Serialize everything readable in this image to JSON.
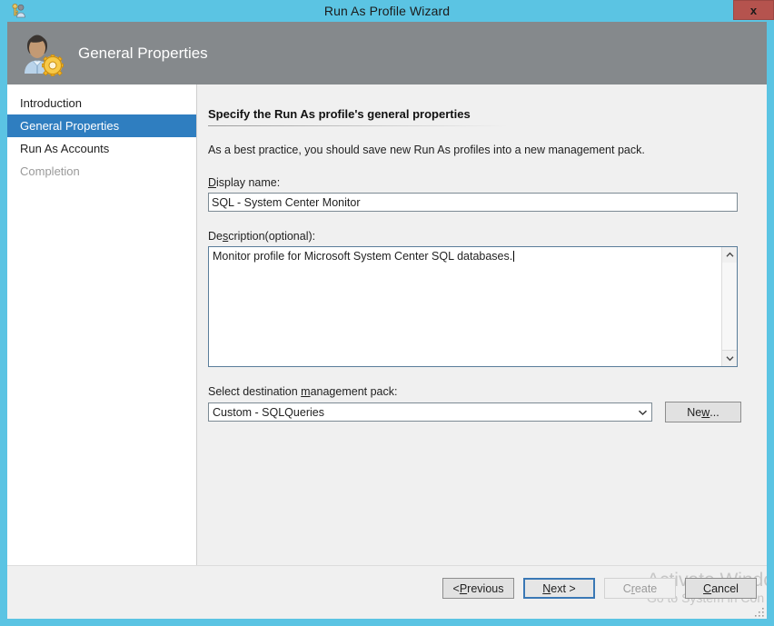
{
  "window": {
    "title": "Run As Profile Wizard",
    "icon": "runas-profile-icon",
    "close_label": "x"
  },
  "banner": {
    "title": "General Properties",
    "icon": "user-gear-icon"
  },
  "sidebar": {
    "items": [
      {
        "label": "Introduction",
        "state": "normal"
      },
      {
        "label": "General Properties",
        "state": "selected"
      },
      {
        "label": "Run As Accounts",
        "state": "normal"
      },
      {
        "label": "Completion",
        "state": "disabled"
      }
    ]
  },
  "content": {
    "heading": "Specify the Run As profile's general properties",
    "best_practice": "As a best practice, you should save new Run As profiles into a new management pack.",
    "display_name": {
      "label_prefix": "",
      "label_accesskey": "D",
      "label_suffix": "isplay name:",
      "value": "SQL - System Center Monitor"
    },
    "description": {
      "label_prefix": "De",
      "label_accesskey": "s",
      "label_suffix": "cription(optional):",
      "value": "Monitor profile for Microsoft System Center SQL databases."
    },
    "management_pack": {
      "label_prefix": "Select destination ",
      "label_accesskey": "m",
      "label_suffix": "anagement pack:",
      "selected": "Custom - SQLQueries",
      "new_button": {
        "prefix": "Ne",
        "accesskey": "w",
        "suffix": "..."
      }
    }
  },
  "footer": {
    "buttons": [
      {
        "prefix": "< ",
        "accesskey": "P",
        "suffix": "revious",
        "state": "normal",
        "name": "previous-button"
      },
      {
        "prefix": "",
        "accesskey": "N",
        "suffix": "ext >",
        "state": "focused",
        "name": "next-button"
      },
      {
        "prefix": "C",
        "accesskey": "r",
        "suffix": "eate",
        "state": "disabled",
        "name": "create-button"
      },
      {
        "prefix": "",
        "accesskey": "C",
        "suffix": "ancel",
        "state": "normal",
        "name": "cancel-button"
      }
    ]
  },
  "watermark": {
    "line1": "Activate Windo",
    "line2": "Go to System in Con"
  },
  "colors": {
    "titlebar": "#5bc4e3",
    "banner": "#85898c",
    "selection": "#2f7ec0",
    "close": "#b5534e",
    "content_bg": "#f0f0f0"
  }
}
